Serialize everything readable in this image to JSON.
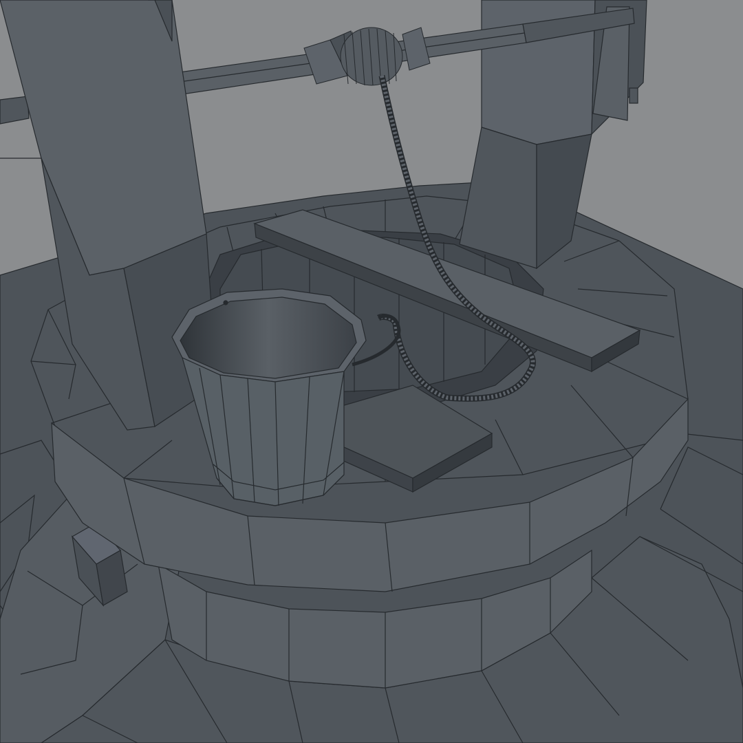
{
  "scene": {
    "subject": "well-3d-wireframe-render",
    "colors": {
      "background": "#8a8c8e",
      "surface": "#4f555b",
      "surface_light": "#5b6167",
      "surface_dark": "#3e4349",
      "wire": "#262a2e"
    }
  }
}
